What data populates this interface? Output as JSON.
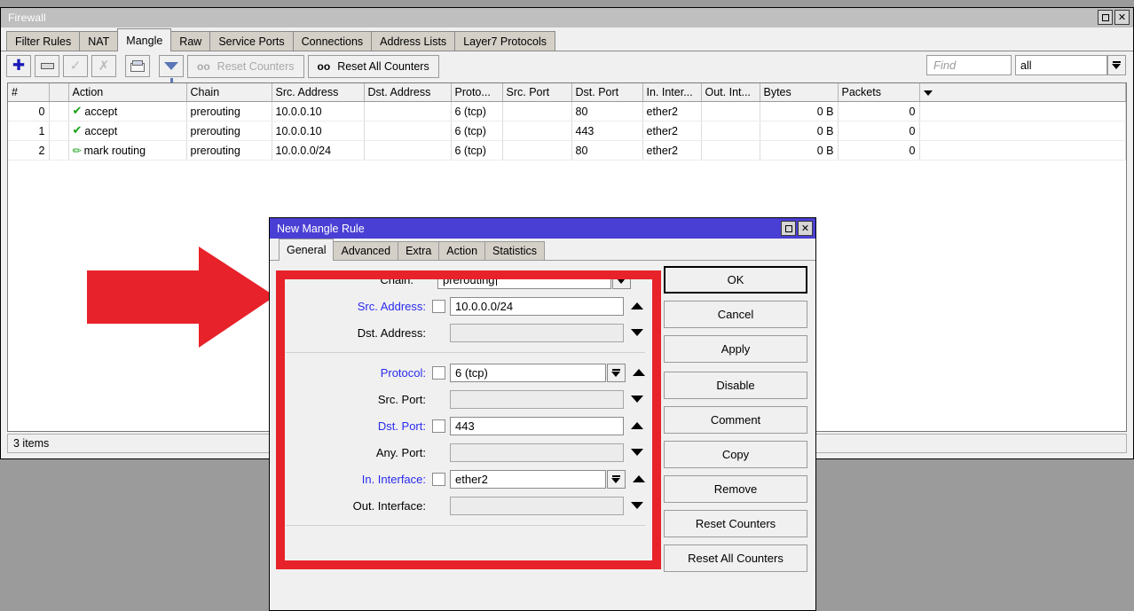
{
  "window": {
    "title": "Firewall",
    "maximize_icon": "maximize-icon",
    "close_icon": "close-icon",
    "close_glyph": "✕"
  },
  "tabs": [
    {
      "label": "Filter Rules",
      "active": false
    },
    {
      "label": "NAT",
      "active": false
    },
    {
      "label": "Mangle",
      "active": true
    },
    {
      "label": "Raw",
      "active": false
    },
    {
      "label": "Service Ports",
      "active": false
    },
    {
      "label": "Connections",
      "active": false
    },
    {
      "label": "Address Lists",
      "active": false
    },
    {
      "label": "Layer7 Protocols",
      "active": false
    }
  ],
  "toolbar": {
    "add_label": "+",
    "remove_label": "−",
    "enable_label": "✓",
    "disable_label": "✕",
    "comment_icon": "comment-icon",
    "filter_icon": "filter-icon",
    "reset_counters": {
      "prefix": "oo",
      "label": "Reset Counters",
      "disabled": true
    },
    "reset_all_counters": {
      "prefix": "oo",
      "label": "Reset All Counters",
      "disabled": false
    },
    "find_placeholder": "Find",
    "find_value": "",
    "find_scope": "all"
  },
  "table": {
    "columns": [
      "#",
      "",
      "Action",
      "Chain",
      "Src. Address",
      "Dst. Address",
      "Proto...",
      "Src. Port",
      "Dst. Port",
      "In. Inter...",
      "Out. Int...",
      "Bytes",
      "Packets",
      ""
    ],
    "rows": [
      {
        "num": "0",
        "flag": "",
        "action": "accept",
        "action_icon": "check-icon",
        "chain": "prerouting",
        "src_address": "10.0.0.10",
        "dst_address": "",
        "protocol": "6 (tcp)",
        "src_port": "",
        "dst_port": "80",
        "in_interface": "ether2",
        "out_interface": "",
        "bytes": "0 B",
        "packets": "0",
        "extra": ""
      },
      {
        "num": "1",
        "flag": "",
        "action": "accept",
        "action_icon": "check-icon",
        "chain": "prerouting",
        "src_address": "10.0.0.10",
        "dst_address": "",
        "protocol": "6 (tcp)",
        "src_port": "",
        "dst_port": "443",
        "in_interface": "ether2",
        "out_interface": "",
        "bytes": "0 B",
        "packets": "0",
        "extra": ""
      },
      {
        "num": "2",
        "flag": "",
        "action": "mark routing",
        "action_icon": "pencil-icon",
        "chain": "prerouting",
        "src_address": "10.0.0.0/24",
        "dst_address": "",
        "protocol": "6 (tcp)",
        "src_port": "",
        "dst_port": "80",
        "in_interface": "ether2",
        "out_interface": "",
        "bytes": "0 B",
        "packets": "0",
        "extra": ""
      }
    ],
    "status": "3 items"
  },
  "dialog": {
    "title": "New Mangle Rule",
    "maximize_icon": "maximize-icon",
    "close_icon": "close-icon",
    "close_glyph": "✕",
    "tabs": [
      {
        "label": "General",
        "active": true
      },
      {
        "label": "Advanced",
        "active": false
      },
      {
        "label": "Extra",
        "active": false
      },
      {
        "label": "Action",
        "active": false
      },
      {
        "label": "Statistics",
        "active": false
      }
    ],
    "fields": [
      {
        "label": "Chain:",
        "value": "prerouting",
        "filled": true,
        "checkbox": false,
        "dropdown": true,
        "spinner": "none",
        "focused": true
      },
      {
        "label": "Src. Address:",
        "value": "10.0.0.0/24",
        "filled": true,
        "checkbox": true,
        "dropdown": false,
        "spinner": "up",
        "focused": false
      },
      {
        "label": "Dst. Address:",
        "value": "",
        "filled": false,
        "checkbox": false,
        "dropdown": false,
        "spinner": "down",
        "focused": false
      },
      {
        "label": "Protocol:",
        "value": "6 (tcp)",
        "filled": true,
        "checkbox": true,
        "dropdown": true,
        "spinner": "up",
        "focused": false
      },
      {
        "label": "Src. Port:",
        "value": "",
        "filled": false,
        "checkbox": false,
        "dropdown": false,
        "spinner": "down",
        "focused": false
      },
      {
        "label": "Dst. Port:",
        "value": "443",
        "filled": true,
        "checkbox": true,
        "dropdown": false,
        "spinner": "up",
        "focused": false
      },
      {
        "label": "Any. Port:",
        "value": "",
        "filled": false,
        "checkbox": false,
        "dropdown": false,
        "spinner": "down",
        "focused": false
      },
      {
        "label": "In. Interface:",
        "value": "ether2",
        "filled": true,
        "checkbox": true,
        "dropdown": true,
        "spinner": "up",
        "focused": false
      },
      {
        "label": "Out. Interface:",
        "value": "",
        "filled": false,
        "checkbox": false,
        "dropdown": false,
        "spinner": "down",
        "focused": false
      }
    ],
    "buttons": [
      {
        "label": "OK",
        "primary": true
      },
      {
        "label": "Cancel",
        "primary": false
      },
      {
        "label": "Apply",
        "primary": false
      },
      {
        "label": "Disable",
        "primary": false
      },
      {
        "label": "Comment",
        "primary": false
      },
      {
        "label": "Copy",
        "primary": false
      },
      {
        "label": "Remove",
        "primary": false
      },
      {
        "label": "Reset Counters",
        "primary": false
      },
      {
        "label": "Reset All Counters",
        "primary": false
      }
    ]
  },
  "annotations": {
    "arrow": "red-arrow-pointing-right",
    "highlight": "red-highlight-rectangle"
  },
  "colors": {
    "dialog_titlebar": "#4a3fd4",
    "annotation_red": "#e8222a",
    "field_label_set": "#2a2af0",
    "accent_blue": "#1919b8",
    "desktop": "#9b9b9b"
  }
}
